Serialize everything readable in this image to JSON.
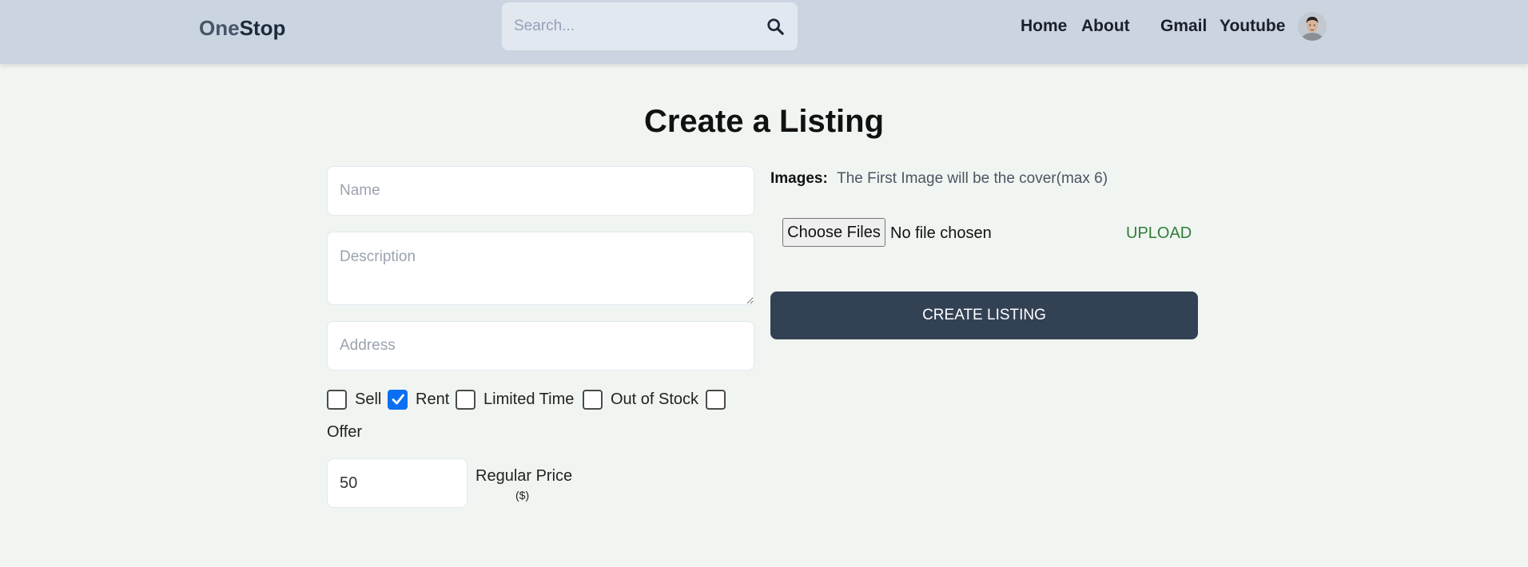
{
  "header": {
    "logo_part1": "One",
    "logo_part2": "Stop",
    "search_placeholder": "Search...",
    "nav": {
      "home": "Home",
      "about": "About",
      "gmail": "Gmail",
      "youtube": "Youtube"
    }
  },
  "main": {
    "title": "Create a Listing",
    "name_placeholder": "Name",
    "description_placeholder": "Description",
    "address_placeholder": "Address",
    "checkboxes": [
      {
        "label": "Sell",
        "checked": false
      },
      {
        "label": "Rent",
        "checked": true
      },
      {
        "label": "Limited Time",
        "checked": false
      },
      {
        "label": "Out of Stock",
        "checked": false
      },
      {
        "label": "Offer",
        "checked": false
      }
    ],
    "price_value": "50",
    "price_label": "Regular Price",
    "price_unit": "($)",
    "images_label": "Images:",
    "images_hint": "The First Image will be the cover(max 6)",
    "choose_files": "Choose Files",
    "file_status": "No file chosen",
    "upload": "UPLOAD",
    "create_button": "CREATE LISTING"
  },
  "colors": {
    "header_bg": "#cbd5e1",
    "page_bg": "#f1f5f1",
    "button_dark": "#334155",
    "checkbox_accent": "#0b6ff2",
    "upload_green": "#2f7d3a"
  }
}
